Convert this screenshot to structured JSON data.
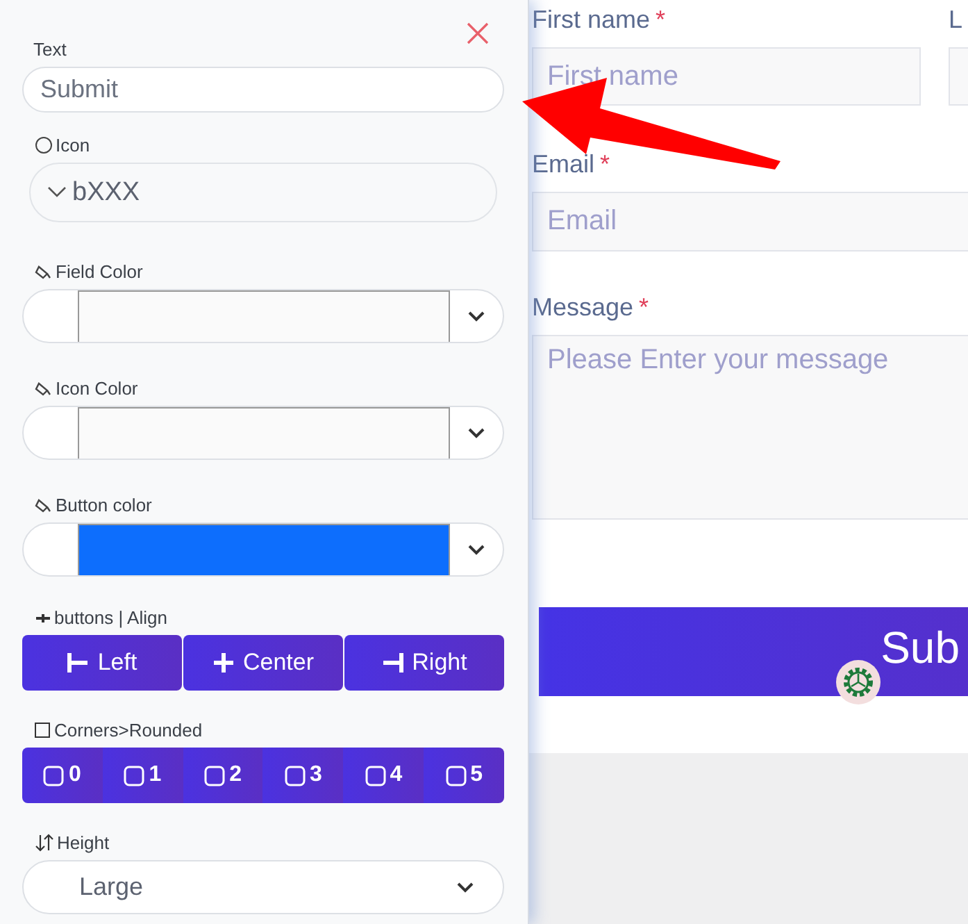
{
  "panel": {
    "text_field": {
      "label": "Text",
      "value": "Submit"
    },
    "icon_field": {
      "label": "Icon",
      "value": "bXXX"
    },
    "color_fields": [
      {
        "label": "Field Color",
        "color": "#fafafa"
      },
      {
        "label": "Icon Color",
        "color": "#fafafa"
      },
      {
        "label": "Button color",
        "color": "#0d6efd"
      }
    ],
    "align": {
      "label": "buttons | Align",
      "options": [
        {
          "label": "Left",
          "kind": "left"
        },
        {
          "label": "Center",
          "kind": "center"
        },
        {
          "label": "Right",
          "kind": "right"
        }
      ]
    },
    "corners": {
      "label": "Corners>Rounded",
      "options": [
        "0",
        "1",
        "2",
        "3",
        "4",
        "5"
      ]
    },
    "height": {
      "label": "Height",
      "value": "Large"
    }
  },
  "form": {
    "first_name": {
      "label": "First name",
      "mark": "*",
      "placeholder": "First name"
    },
    "column_2": {
      "label": "L"
    },
    "email": {
      "label": "Email",
      "mark": "*",
      "placeholder": "Email"
    },
    "message": {
      "label": "Message",
      "mark": "*",
      "placeholder": "Please Enter your message"
    },
    "submit": {
      "label": "Sub"
    }
  }
}
